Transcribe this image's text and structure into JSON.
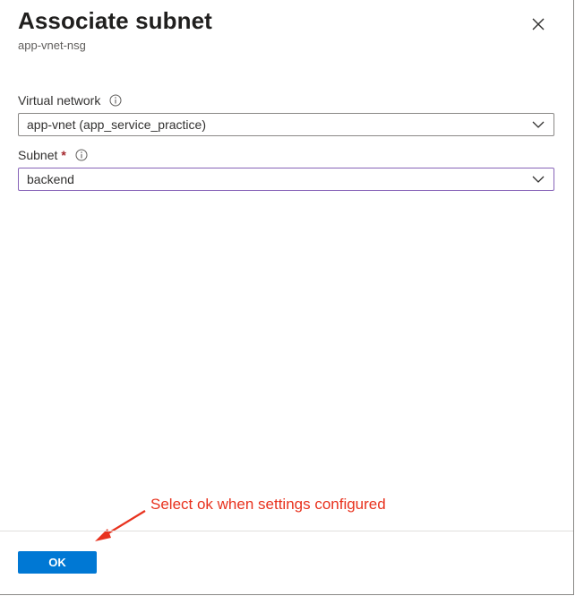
{
  "dialog": {
    "title": "Associate subnet",
    "subtitle": "app-vnet-nsg",
    "close_icon": "close-icon"
  },
  "fields": {
    "virtual_network": {
      "label": "Virtual network",
      "required": false,
      "info_icon": "info-icon",
      "value": "app-vnet (app_service_practice)",
      "chevron_icon": "chevron-down-icon"
    },
    "subnet": {
      "label": "Subnet",
      "required": true,
      "required_marker": "*",
      "info_icon": "info-icon",
      "value": "backend",
      "chevron_icon": "chevron-down-icon"
    }
  },
  "footer": {
    "ok_label": "OK"
  },
  "annotation": {
    "text": "Select ok when settings configured",
    "color": "#e8321e"
  },
  "colors": {
    "primary_button": "#0078d4",
    "focused_border": "#8764b8",
    "required_marker": "#a4262c"
  }
}
